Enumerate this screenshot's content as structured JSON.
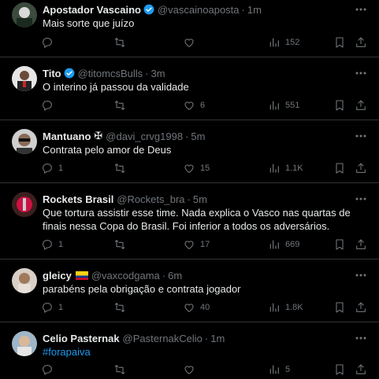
{
  "colors": {
    "background": "#000000",
    "text": "#e7e9ea",
    "muted": "#71767b",
    "verified": "#1d9bf0",
    "hashtag": "#1d9bf0",
    "divider": "#2f3336"
  },
  "tweets": [
    {
      "name": "Apostador Vascaino",
      "verified": true,
      "handle": "@vascainoaposta",
      "dot": "·",
      "time": "1m",
      "text": "Mais sorte que juízo",
      "replies": "",
      "reposts": "",
      "likes": "",
      "views": "152"
    },
    {
      "name": "Tito",
      "verified": true,
      "handle": "@titomcsBulls",
      "dot": "·",
      "time": "3m",
      "text": "O interino já passou da validade",
      "replies": "",
      "reposts": "",
      "likes": "6",
      "views": "551"
    },
    {
      "name": "Mantuano",
      "emoji": "✠",
      "handle": "@davi_crvg1998",
      "dot": "·",
      "time": "5m",
      "text": "Contrata pelo amor de Deus",
      "replies": "1",
      "reposts": "",
      "likes": "15",
      "views": "1.1K"
    },
    {
      "name": "Rockets Brasil",
      "handle": "@Rockets_bra",
      "dot": "·",
      "time": "5m",
      "text": "Que tortura assistir esse time. Nada explica o Vasco nas quartas de finais nessa Copa do Brasil. Foi inferior a todos os adversários.",
      "replies": "1",
      "reposts": "",
      "likes": "17",
      "views": "669"
    },
    {
      "name": "gleicy",
      "flag": "colombia-flag-icon",
      "handle": "@vaxcodgama",
      "dot": "·",
      "time": "6m",
      "text": "parabéns pela obrigação e contrata jogador",
      "replies": "1",
      "reposts": "",
      "likes": "40",
      "views": "1.8K"
    },
    {
      "name": "Celio Pasternak",
      "handle": "@PasternakCelio",
      "dot": "·",
      "time": "1m",
      "text": "#forapaiva",
      "replies": "",
      "reposts": "",
      "likes": "",
      "views": "5"
    }
  ]
}
